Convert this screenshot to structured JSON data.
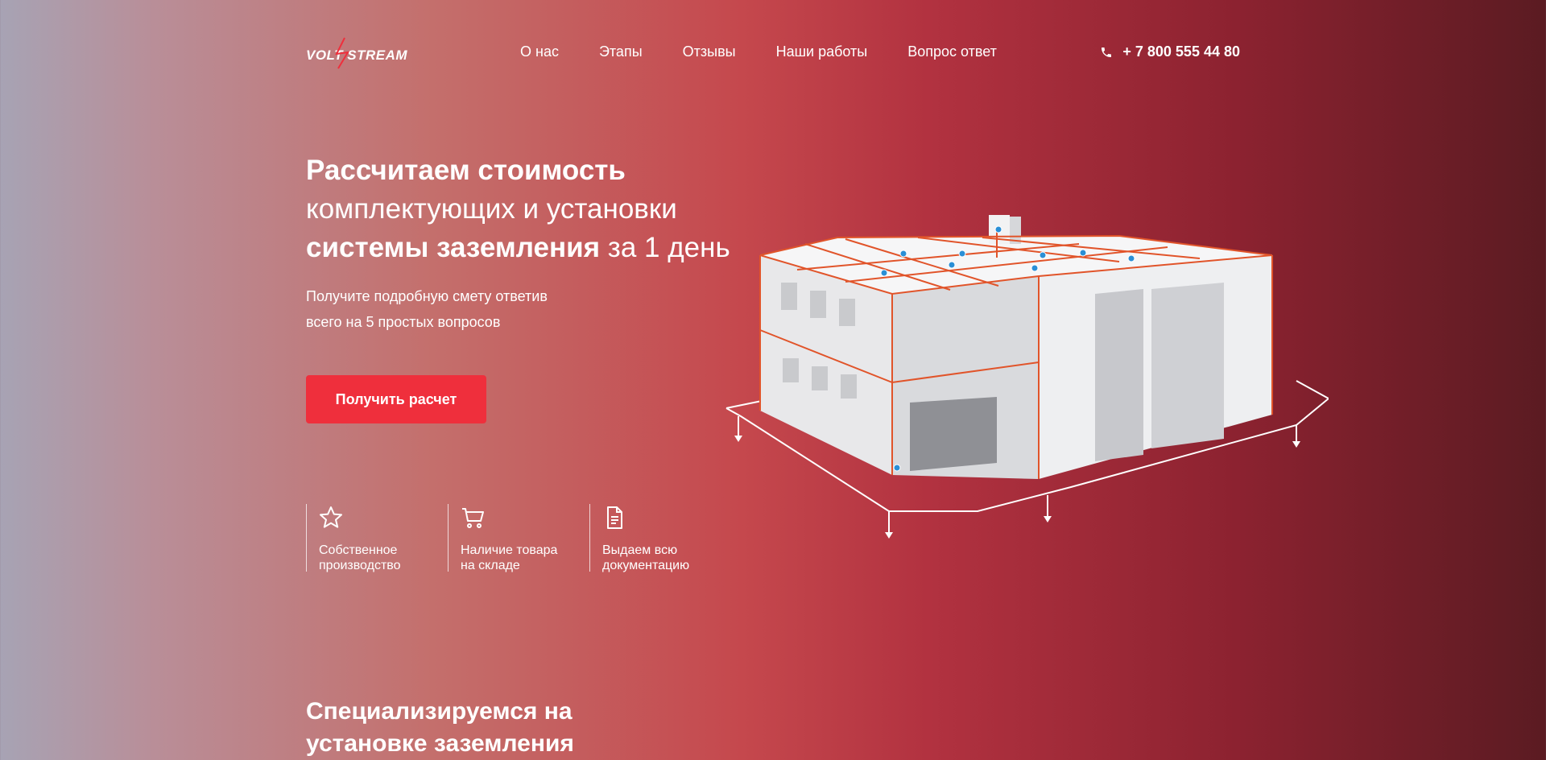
{
  "header": {
    "logo_text": "VOLT STREAM",
    "nav": [
      "О нас",
      "Этапы",
      "Отзывы",
      "Наши работы",
      "Вопрос ответ"
    ],
    "phone_icon": "phone-icon",
    "phone": "+ 7 800 555 44 80"
  },
  "hero": {
    "title_part1_bold": "Рассчитаем стоимость",
    "title_part2": "комплектующих и установки",
    "title_part3_bold": "системы заземления",
    "title_part4": " за 1 день",
    "subtitle_line1": "Получите подробную смету ответив",
    "subtitle_line2": "всего на 5 простых вопросов",
    "cta_label": "Получить расчет"
  },
  "features": [
    {
      "icon": "star-icon",
      "line1": "Собственное",
      "line2": "производство"
    },
    {
      "icon": "cart-icon",
      "line1": "Наличие товара",
      "line2": "на складе"
    },
    {
      "icon": "document-icon",
      "line1": "Выдаем всю",
      "line2": "документацию"
    }
  ],
  "section": {
    "title_line1": "Специализируемся на",
    "title_line2": "установке заземления"
  },
  "colors": {
    "accent": "#ef2f3c",
    "bg_left": "#a7a3b4",
    "bg_mid": "#c5484d",
    "bg_right": "#5b1b22"
  }
}
